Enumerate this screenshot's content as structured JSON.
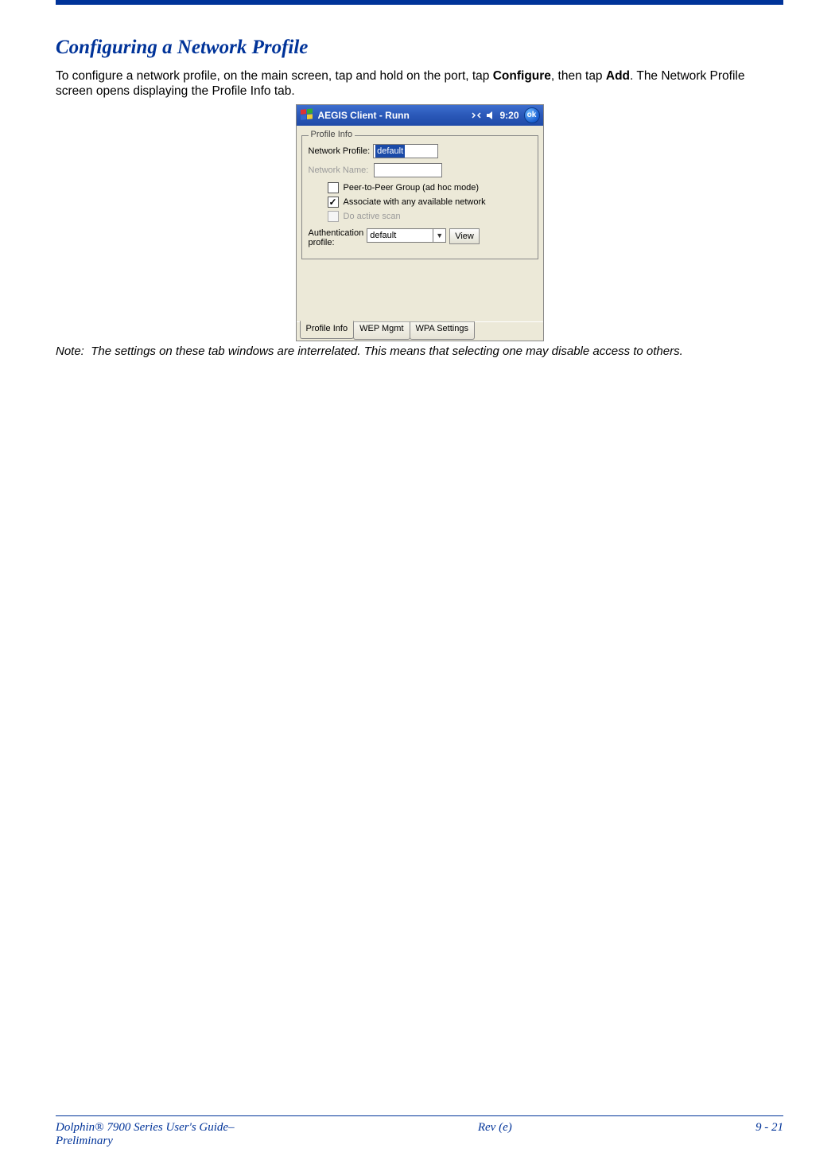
{
  "page": {
    "heading": "Configuring a Network Profile",
    "intro_pre": "To configure a network profile, on the main screen, tap and hold on the port, tap ",
    "intro_bold1": "Configure",
    "intro_mid": ", then tap ",
    "intro_bold2": "Add",
    "intro_post": ". The Network Profile screen opens displaying the Profile Info tab.",
    "note_label": "Note:",
    "note_text": "The settings on these tab windows are interrelated. This means that selecting one may disable access to others."
  },
  "screenshot": {
    "title": "AEGIS Client - Runn",
    "time": "9:20",
    "ok": "ok",
    "fieldset_legend": "Profile Info",
    "network_profile_label": "Network Profile:",
    "network_profile_value": "default",
    "network_name_label": "Network Name:",
    "network_name_value": "",
    "chk_peer": "Peer-to-Peer Group (ad hoc mode)",
    "chk_assoc": "Associate with any available network",
    "chk_scan": "Do active scan",
    "auth_label_line1": "Authentication",
    "auth_label_line2": "profile:",
    "auth_value": "default",
    "view_btn": "View",
    "tabs": [
      "Profile Info",
      "WEP Mgmt",
      "WPA Settings"
    ]
  },
  "footer": {
    "left_line1": "Dolphin® 7900 Series User's Guide–",
    "left_line2": "Preliminary",
    "center": "Rev (e)",
    "right": "9 - 21"
  }
}
